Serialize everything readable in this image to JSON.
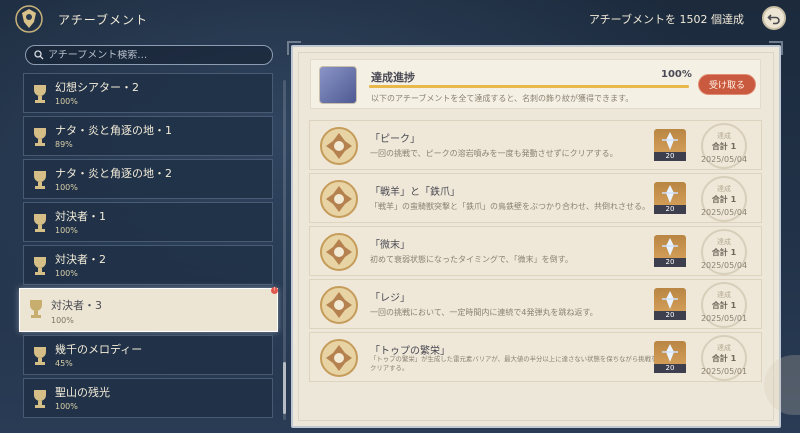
{
  "header": {
    "title": "アチーブメント",
    "count_text": "アチーブメントを 1502 個達成"
  },
  "search": {
    "placeholder": "アチーブメント検索…"
  },
  "categories": [
    {
      "name": "幻想シアター・2",
      "percent": "100%"
    },
    {
      "name": "ナタ・炎と角逐の地・1",
      "percent": "89%"
    },
    {
      "name": "ナタ・炎と角逐の地・2",
      "percent": "100%"
    },
    {
      "name": "対決者・1",
      "percent": "100%"
    },
    {
      "name": "対決者・2",
      "percent": "100%"
    },
    {
      "name": "対決者・3",
      "percent": "100%",
      "selected": true,
      "badge": "!"
    },
    {
      "name": "幾千のメロディー",
      "percent": "45%"
    },
    {
      "name": "聖山の残光",
      "percent": "100%"
    }
  ],
  "progress": {
    "title": "達成進捗",
    "percent_text": "100%",
    "fraction": 1.0,
    "description": "以下のアチーブメントを全て達成すると、名刺の飾り紋が獲得できます。",
    "claim_label": "受け取る"
  },
  "achievements": [
    {
      "title": "「ピーク」",
      "description": "一回の挑戦で、ピークの溶岩噴みを一度も発動させずにクリアする。",
      "reward_qty": "20",
      "stamp_label": "達成",
      "stamp_total": "合計 1",
      "date": "2025/05/04"
    },
    {
      "title": "「戦羊」と「鉄爪」",
      "description": "「戦羊」の蛮騎獣突撃と「鉄爪」の鳥鉄壁をぶつかり合わせ、共倒れさせる。",
      "reward_qty": "20",
      "stamp_label": "達成",
      "stamp_total": "合計 1",
      "date": "2025/05/04"
    },
    {
      "title": "「微末」",
      "description": "初めて衰弱状態になったタイミングで、「微末」を倒す。",
      "reward_qty": "20",
      "stamp_label": "達成",
      "stamp_total": "合計 1",
      "date": "2025/05/04"
    },
    {
      "title": "「レジ」",
      "description": "一回の挑戦において、一定時間内に連続で4発弾丸を跳ね返す。",
      "reward_qty": "20",
      "stamp_label": "達成",
      "stamp_total": "合計 1",
      "date": "2025/05/01"
    },
    {
      "title": "「トゥプの繁栄」",
      "description": "「トゥプの繁栄」が生成した雷元素バリアが、最大値の半分以上に達さない状態を保ちながら挑戦をクリアする。",
      "reward_qty": "20",
      "stamp_label": "達成",
      "stamp_total": "合計 1",
      "date": "2025/05/01"
    }
  ],
  "colors": {
    "accent": "#e9b84a",
    "claim": "#c95a3f",
    "panel": "#ede7da"
  }
}
